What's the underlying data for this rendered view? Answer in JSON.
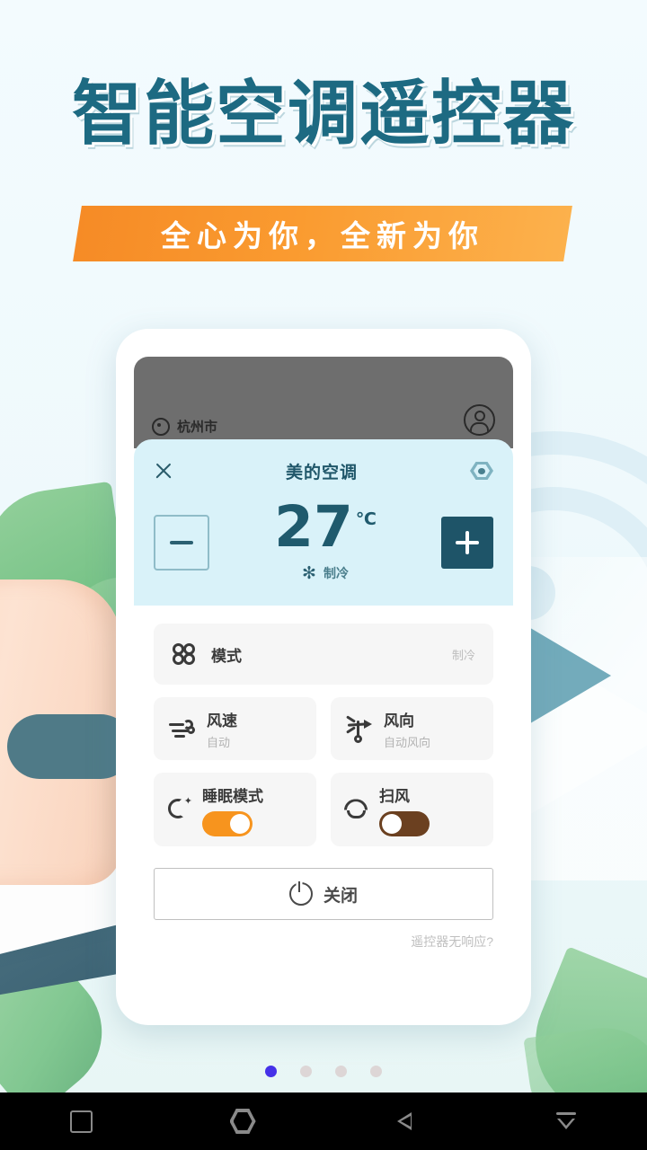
{
  "hero": {
    "title": "智能空调遥控器",
    "banner": "全心为你，全新为你",
    "title_color": "#1d6a82",
    "banner_color_start": "#f68b26",
    "banner_color_end": "#fcb14c"
  },
  "phone": {
    "header": {
      "location": "杭州市",
      "location_icon": "location-pin-icon",
      "account_icon": "account-avatar-icon"
    },
    "panel": {
      "close_icon": "close-icon",
      "device_name": "美的空调",
      "settings_icon": "hex-settings-icon",
      "minus_label": "−",
      "plus_label": "+",
      "temperature": "27",
      "unit": "℃",
      "mode_icon": "snowflake-icon",
      "mode_text": "制冷",
      "bg_color": "#d9f2f9",
      "accent_color": "#1e5468"
    },
    "controls": {
      "mode_row": {
        "icon": "clover-mode-icon",
        "label": "模式",
        "value": "制冷"
      },
      "fan_speed": {
        "icon": "wind-speed-icon",
        "label": "风速",
        "value": "自动"
      },
      "wind_dir": {
        "icon": "wind-vane-icon",
        "label": "风向",
        "value": "自动风向"
      },
      "sleep_mode": {
        "icon": "moon-sleep-icon",
        "label": "睡眠模式",
        "state": "on",
        "on_color": "#f7941e"
      },
      "swing": {
        "icon": "swing-airflow-icon",
        "label": "扫风",
        "state": "off",
        "off_color": "#6b4020"
      }
    },
    "power": {
      "icon": "power-icon",
      "label": "关闭"
    },
    "helper_link": "遥控器无响应?"
  },
  "pager": {
    "total": 4,
    "active_index": 0,
    "active_color": "#4531e8",
    "inactive_color": "#ddd6d6"
  },
  "navbar": {
    "recents": "recents-square-icon",
    "home": "home-hexagon-icon",
    "back": "back-triangle-icon",
    "hide": "hide-navbar-icon"
  }
}
